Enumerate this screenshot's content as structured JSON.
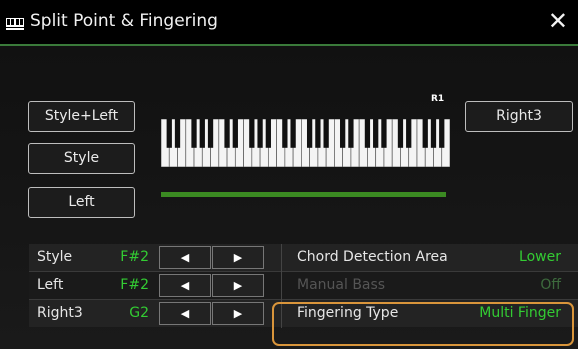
{
  "window": {
    "title": "Split Point & Fingering",
    "title_icon": "keyboard-icon",
    "close_label": "✕"
  },
  "buttons": {
    "style_left": "Style+Left",
    "style": "Style",
    "left": "Left",
    "right3": "Right3"
  },
  "keyboard": {
    "marker_label": "R1"
  },
  "split_rows": [
    {
      "label": "Style",
      "value": "F#2",
      "prev": "◀",
      "next": "▶"
    },
    {
      "label": "Left",
      "value": "F#2",
      "prev": "◀",
      "next": "▶"
    },
    {
      "label": "Right3",
      "value": "G2",
      "prev": "◀",
      "next": "▶"
    }
  ],
  "settings": [
    {
      "label": "Chord Detection Area",
      "value": "Lower",
      "enabled": true
    },
    {
      "label": "Manual Bass",
      "value": "Off",
      "enabled": false
    },
    {
      "label": "Fingering Type",
      "value": "Multi Finger",
      "enabled": true
    }
  ],
  "colors": {
    "accent_green": "#33cc33",
    "range_bar": "#3b8a22",
    "highlight": "#d9953b"
  }
}
